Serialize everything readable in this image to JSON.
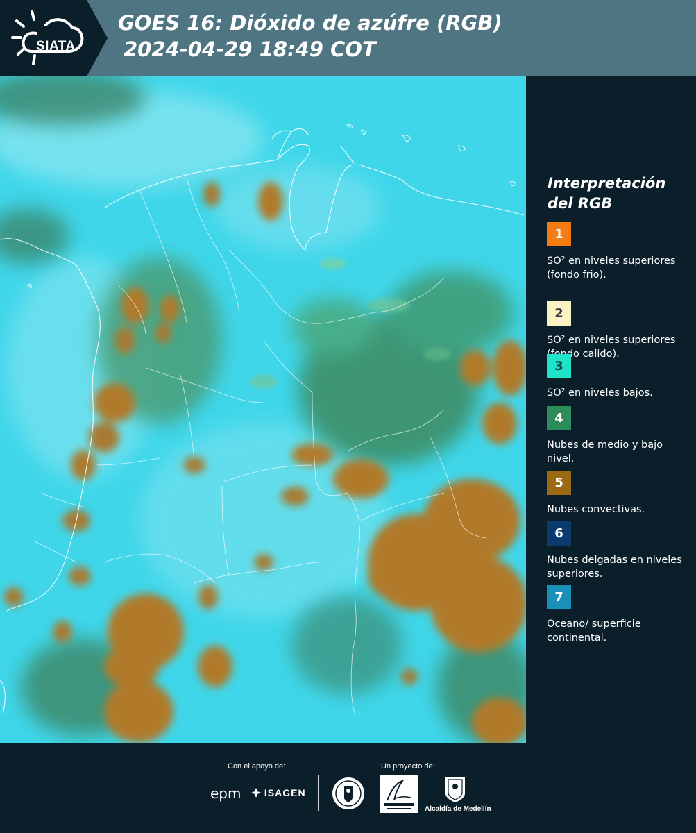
{
  "header": {
    "logo_text": "SIATA",
    "title_line1": "GOES 16: Dióxido de azúfre (RGB)",
    "title_line2": "2024-04-29 18:49 COT"
  },
  "legend": {
    "title": "Interpretación del RGB",
    "items": [
      {
        "number": "1",
        "color": "#f47c12",
        "text": "SO² en niveles superiores (fondo frio)."
      },
      {
        "number": "2",
        "color": "#fcf3c4",
        "text": "SO² en niveles superiores (fondo calido)."
      },
      {
        "number": "3",
        "color": "#1fe3c8",
        "text": "SO² en niveles bajos."
      },
      {
        "number": "4",
        "color": "#2e8b5a",
        "text": "Nubes de medio y bajo nivel."
      },
      {
        "number": "5",
        "color": "#9b6a12",
        "text": "Nubes convectivas."
      },
      {
        "number": "6",
        "color": "#0c3a6e",
        "text": "Nubes delgadas en niveles superiores."
      },
      {
        "number": "7",
        "color": "#1a8fb8",
        "text": "Oceano/ superficie continental."
      }
    ]
  },
  "footer": {
    "support_label": "Con el apoyo de:",
    "project_label": "Un proyecto de:",
    "sponsor1": "epm",
    "sponsor2": "ISAGEN",
    "partner1": "Area Metropolitana Valle de Aburrá",
    "partner2": "Alcaldía de Medellín"
  },
  "colors": {
    "ocean_cyan": "#3fd6ea",
    "cloud_orange": "#b07a2c",
    "cloud_green": "#3d8a5e",
    "background": "#0b1f2b",
    "header_band": "#4f7482"
  }
}
